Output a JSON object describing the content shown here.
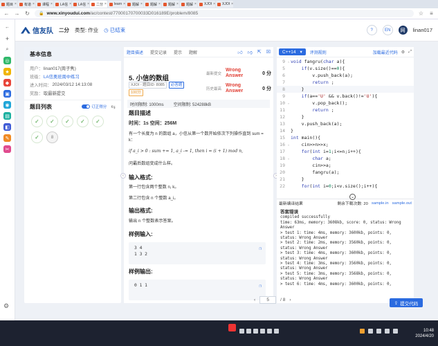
{
  "browser": {
    "tabs": [
      {
        "label": "题目"
      },
      {
        "label": "有道"
      },
      {
        "label": "课程"
      },
      {
        "label": "LA信"
      },
      {
        "label": "LA信"
      },
      {
        "label": "二分",
        "active": true
      },
      {
        "label": "learn"
      },
      {
        "label": "题解"
      },
      {
        "label": "题解"
      },
      {
        "label": "题解"
      },
      {
        "label": "题解"
      },
      {
        "label": "XJOI"
      },
      {
        "label": "XJOI"
      }
    ],
    "url_host": "www.xinyoudui.com",
    "url_path": "/ac/contest/77000170700033D016189E/problem/8085"
  },
  "header": {
    "logo_text": "信友队",
    "nav_label": "二分",
    "type_label": "类型: 作业",
    "status_label": "已结束",
    "lang_toggle": "EN",
    "user": "linan017",
    "avatar_letter": "网"
  },
  "info": {
    "title": "基本信息",
    "rows": [
      {
        "k": "用户：",
        "v": "linan017(周子隽)"
      },
      {
        "k": "班级：",
        "v": "LA信奥班周中练习",
        "blue": true
      },
      {
        "k": "进入时间：",
        "v": "2024/03/12 14:13:08"
      },
      {
        "k": "奖励：",
        "v": "取最新提交"
      }
    ]
  },
  "problem_list": {
    "title": "题目列表",
    "toggle_label": "订正得分",
    "items": [
      "✓",
      "✓",
      "✓",
      "✓",
      "✓",
      "✓",
      "8"
    ]
  },
  "problem": {
    "tabs": [
      "题目描述",
      "提交记录",
      "提示",
      "题解"
    ],
    "title": "5. 小信的数组",
    "source_chip": "XJOI - 题目ID: 8085",
    "tag_chip": "必答题",
    "score_chip": "100分",
    "status_rows": [
      {
        "label": "最新提交",
        "verdict": "Wrong Answer",
        "score": "0 分"
      },
      {
        "label": "历史最高",
        "verdict": "Wrong Answer",
        "score": "0 分"
      }
    ],
    "time_limit": "时间限制: 1000ms",
    "memory_limit": "空间限制: 524288kB",
    "desc_heading": "题目描述",
    "desc_line1": "时间：1s 空间：256M",
    "desc_line2": "有一个长度为 n 的数组 a，小信从第一个数开始依次下列操作直到 sum = k：",
    "desc_line3": "if a_i > 0 : sum += 1, a_i -= 1,  then i = (i + 1) mod n,",
    "desc_line4": "问最后数组变成什么样。",
    "input_heading": "输入格式:",
    "input_line1": "第一行包含两个整数 n, k。",
    "input_line2": "第二行包含 n 个整数 a_i。",
    "output_heading": "输出格式:",
    "output_line1": "输出 n 个整数表示答案。",
    "sample_in_heading": "样例输入:",
    "sample_in": [
      "3 4",
      "1 3 2"
    ],
    "sample_out_heading": "样例输出:",
    "sample_out": [
      "0 1 1"
    ]
  },
  "editor": {
    "language": "C++14",
    "link_rules": "评测规则",
    "link_load": "加载最近代码",
    "lines": [
      {
        "n": "9",
        "fold": true,
        "t": "void fangru(char a){"
      },
      {
        "n": "5",
        "t": "    if(v.size()==0){"
      },
      {
        "n": "6",
        "t": "        v.push_back(a);"
      },
      {
        "n": "7",
        "t": "        return ;"
      },
      {
        "n": "8",
        "t": "    }",
        "hl": true
      },
      {
        "n": "9",
        "t": "    if(a=='U' && v.back()!='U'){"
      },
      {
        "n": "10",
        "fold": true,
        "t": "        v.pop_back();"
      },
      {
        "n": "11",
        "t": "        return ;"
      },
      {
        "n": "12",
        "t": "    }"
      },
      {
        "n": "13",
        "t": "    v.push_back(a);"
      },
      {
        "n": "14",
        "t": "}"
      },
      {
        "n": "15",
        "t": "int main(){"
      },
      {
        "n": "16",
        "fold": true,
        "t": "    cin>>n>>x;"
      },
      {
        "n": "17",
        "t": "    for(int i=1;i<=n;i++){"
      },
      {
        "n": "18",
        "fold": true,
        "t": "        char a;"
      },
      {
        "n": "19",
        "t": "        cin>>a;"
      },
      {
        "n": "20",
        "t": "        fangru(a);"
      },
      {
        "n": "21",
        "t": "    }"
      },
      {
        "n": "22",
        "t": "    for(int i=0;i<v.size();i++){"
      }
    ],
    "result_tab": "最新编译结果",
    "remaining": "剩余下载次数: 20",
    "sample_in_link": "sample.in",
    "sample_out_link": "sample.out",
    "result_title": "答案错误",
    "result_lines": [
      "compiled successfully",
      "time: 63ms, memory: 3608kb, score: 0, status: Wrong Answer",
      "> test 1: time: 4ms, memory: 3600kb, points: 0, status: Wrong Answer",
      "> test 2: time: 2ms, memory: 3560kb, points: 0, status: Wrong Answer",
      "> test 3: time: 4ms, memory: 3600kb, points: 0, status: Wrong Answer",
      "> test 4: time: 3ms, memory: 3560kb, points: 0, status: Wrong Answer",
      "> test 5: time: 3ms, memory: 3568kb, points: 0, status: Wrong Answer",
      "> test 6: time: 4ms, memory: 3600kb, points: 0,"
    ],
    "submit_label": "提交代码"
  },
  "pager": {
    "current": "5",
    "total": "/ 8"
  },
  "taskbar": {
    "time": "10:48",
    "date": "2024/4/20"
  }
}
